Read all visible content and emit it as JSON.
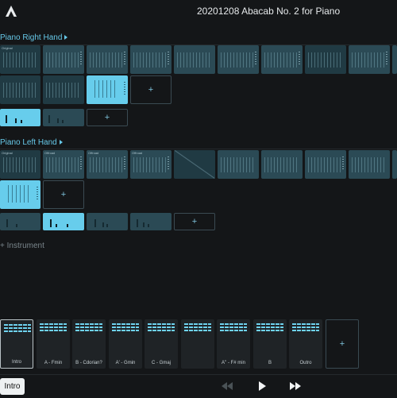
{
  "app": {
    "title": "20201208 Abacab No. 2 for Piano",
    "logo_icon": "abacab-logo-icon"
  },
  "tracks": [
    {
      "name": "Piano Right Hand",
      "pattern_labels": [
        "Original",
        "",
        "",
        "",
        "",
        "",
        "",
        "",
        ""
      ],
      "add_pattern_label": "+",
      "add_clip_label": "+"
    },
    {
      "name": "Piano Left Hand",
      "pattern_labels": [
        "Original",
        "Offroad",
        "Offroad",
        "Offroad",
        "",
        "",
        "",
        "",
        ""
      ],
      "add_pattern_label": "+",
      "add_clip_label": "+"
    }
  ],
  "add_instrument_label": "+ Instrument",
  "scenes": [
    {
      "label": "Intro"
    },
    {
      "label": "A - Fmin"
    },
    {
      "label": "B - Cdorian?"
    },
    {
      "label": "A' - Gmin"
    },
    {
      "label": "C - Gmaj"
    },
    {
      "label": ""
    },
    {
      "label": "A'' - F# min"
    },
    {
      "label": "B"
    },
    {
      "label": "Outro"
    }
  ],
  "add_scene_label": "+",
  "transport": {
    "current_scene": "Intro",
    "icons": [
      "rewind-icon",
      "play-icon",
      "fast-forward-icon"
    ]
  },
  "colors": {
    "accent": "#67cdec",
    "background": "#141618"
  }
}
